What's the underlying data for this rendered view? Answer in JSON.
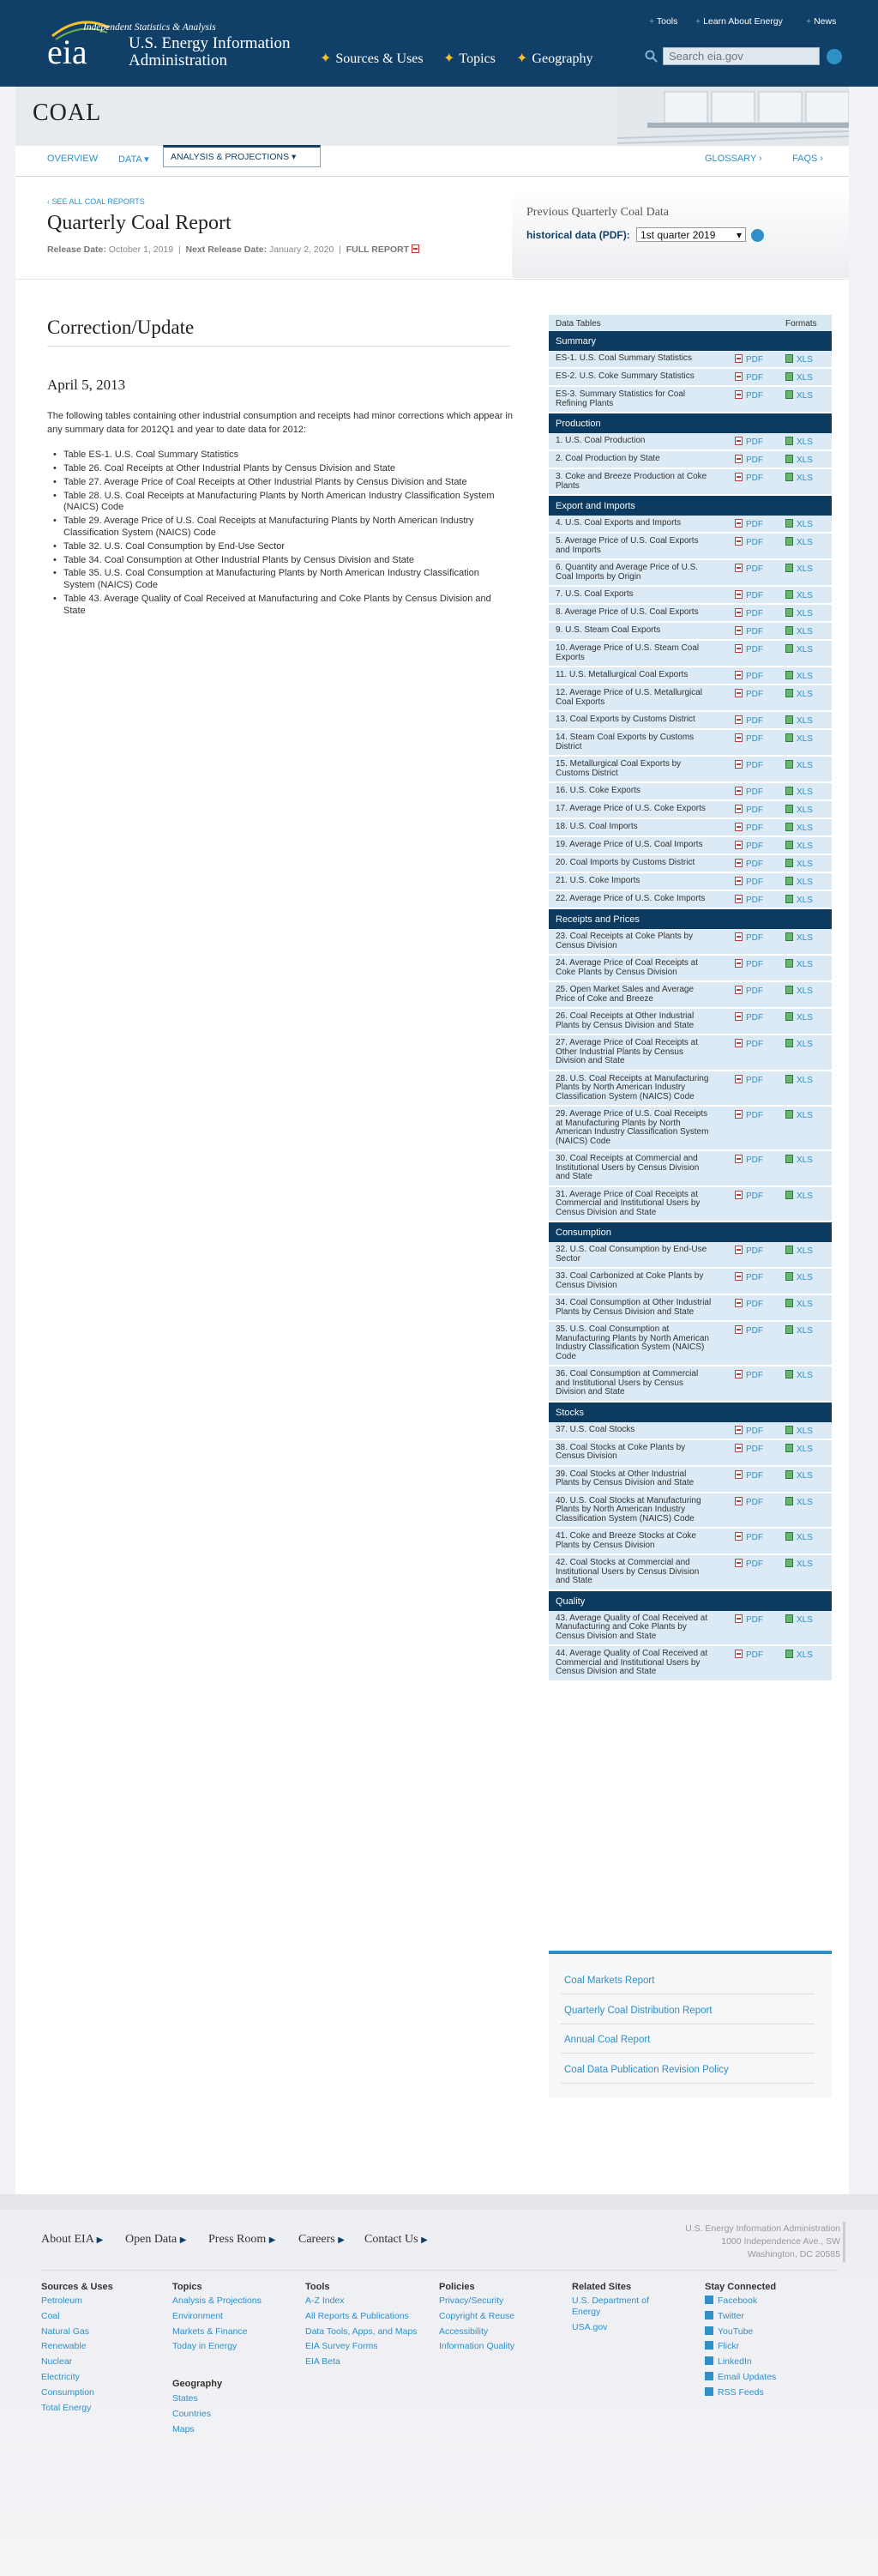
{
  "header": {
    "logo": "eia",
    "logo_tagline": "Independent Statistics & Analysis",
    "agency": "U.S. Energy Information Administration",
    "toplinks": [
      "Tools",
      "Learn About Energy",
      "News"
    ],
    "nav": [
      "Sources & Uses",
      "Topics",
      "Geography"
    ],
    "search_placeholder": "Search eia.gov"
  },
  "band": {
    "title": "COAL"
  },
  "tabs": {
    "overview": "OVERVIEW",
    "data": "DATA",
    "analysis": "ANALYSIS & PROJECTIONS",
    "glossary": "GLOSSARY ›",
    "faqs": "FAQS ›"
  },
  "report": {
    "crumb": "‹ SEE ALL COAL REPORTS",
    "title": "Quarterly Coal Report",
    "release_label": "Release Date:",
    "release_date": "October 1, 2019",
    "next_label": "Next Release Date:",
    "next_date": "January 2, 2020",
    "full_report": "FULL REPORT"
  },
  "previous": {
    "heading": "Previous Quarterly Coal Data",
    "label": "historical data (PDF):",
    "selected": "1st quarter 2019"
  },
  "correction": {
    "heading": "Correction/Update",
    "date": "April 5, 2013",
    "intro": "The following tables containing other industrial consumption and receipts had minor corrections which appear in any summary data for 2012Q1 and year to date data for 2012:",
    "items": [
      "Table ES-1. U.S. Coal Summary Statistics",
      "Table 26. Coal Receipts at Other Industrial Plants by Census Division and State",
      "Table 27. Average Price of Coal Receipts at Other Industrial Plants by Census Division and State",
      "Table 28. U.S. Coal Receipts at Manufacturing Plants by North American Industry Classification System (NAICS) Code",
      "Table 29. Average Price of U.S. Coal Receipts at Manufacturing Plants by North American Industry Classification System (NAICS) Code",
      "Table 32. U.S. Coal Consumption by End-Use Sector",
      "Table 34. Coal Consumption at Other Industrial Plants by Census Division and State",
      "Table 35. U.S. Coal Consumption at Manufacturing Plants by North American Industry Classification System (NAICS) Code",
      "Table 43. Average Quality of Coal Received at Manufacturing and Coke Plants by Census Division and State"
    ]
  },
  "data_tables": {
    "col1": "Data Tables",
    "col2": "Formats",
    "pdf": "PDF",
    "xls": "XLS",
    "sections": [
      {
        "title": "Summary",
        "rows": [
          "ES-1. U.S. Coal Summary Statistics",
          "ES-2. U.S. Coke Summary Statistics",
          "ES-3. Summary Statistics for Coal Refining Plants"
        ]
      },
      {
        "title": "Production",
        "rows": [
          "1. U.S. Coal Production",
          "2. Coal Production by State",
          "3. Coke and Breeze Production at Coke Plants"
        ]
      },
      {
        "title": "Export and Imports",
        "rows": [
          "4. U.S. Coal Exports and Imports",
          "5. Average Price of U.S. Coal Exports and Imports",
          "6. Quantity and Average Price of U.S. Coal Imports by Origin",
          "7. U.S. Coal Exports",
          "8. Average Price of U.S. Coal Exports",
          "9. U.S. Steam Coal Exports",
          "10. Average Price of U.S. Steam Coal Exports",
          "11. U.S. Metallurgical Coal Exports",
          "12. Average Price of U.S. Metallurgical Coal Exports",
          "13. Coal Exports by Customs District",
          "14. Steam Coal Exports by Customs District",
          "15. Metallurgical Coal Exports by Customs District",
          "16. U.S. Coke Exports",
          "17. Average Price of U.S. Coke Exports",
          "18. U.S. Coal Imports",
          "19. Average Price of U.S. Coal Imports",
          "20. Coal Imports by Customs District",
          "21. U.S. Coke Imports",
          "22. Average Price of U.S. Coke Imports"
        ]
      },
      {
        "title": "Receipts and Prices",
        "rows": [
          "23. Coal Receipts at Coke Plants by Census Division",
          "24. Average Price of Coal Receipts at Coke Plants by Census Division",
          "25. Open Market Sales and Average Price of Coke and Breeze",
          "26. Coal Receipts at Other Industrial Plants by Census Division and State",
          "27. Average Price of Coal Receipts at Other Industrial Plants by Census Division and State",
          "28. U.S. Coal Receipts at Manufacturing Plants by North American Industry Classification System (NAICS) Code",
          "29. Average Price of U.S. Coal Receipts at Manufacturing Plants by North American Industry Classification System (NAICS) Code",
          "30. Coal Receipts at Commercial and Institutional Users by Census Division and State",
          "31. Average Price of Coal Receipts at Commercial and Institutional Users by Census Division and State"
        ]
      },
      {
        "title": "Consumption",
        "rows": [
          "32. U.S. Coal Consumption by End-Use Sector",
          "33. Coal Carbonized at Coke Plants by Census Division",
          "34. Coal Consumption at Other Industrial Plants by Census Division and State",
          "35. U.S. Coal Consumption at Manufacturing Plants by North American Industry Classification System (NAICS) Code",
          "36. Coal Consumption at Commercial and Institutional Users by Census Division and State"
        ]
      },
      {
        "title": "Stocks",
        "rows": [
          "37. U.S. Coal Stocks",
          "38. Coal Stocks at Coke Plants by Census Division",
          "39. Coal Stocks at Other Industrial Plants by Census Division and State",
          "40. U.S. Coal Stocks at Manufacturing Plants by North American Industry Classification System (NAICS) Code",
          "41. Coke and Breeze Stocks at Coke Plants by Census Division",
          "42. Coal Stocks at Commercial and Institutional Users by Census Division and State"
        ]
      },
      {
        "title": "Quality",
        "rows": [
          "43. Average Quality of Coal Received at Manufacturing and Coke Plants by Census Division and State",
          "44. Average Quality of Coal Received at Commercial and Institutional Users by Census Division and State"
        ]
      }
    ]
  },
  "related": [
    "Coal Markets Report",
    "Quarterly Coal Distribution Report",
    "Annual Coal Report",
    "Coal Data Publication Revision Policy"
  ],
  "footer": {
    "nav": [
      "About EIA",
      "Open Data",
      "Press Room",
      "Careers",
      "Contact Us"
    ],
    "address": [
      "U.S. Energy Information Administration",
      "1000 Independence Ave., SW",
      "Washington, DC 20585"
    ],
    "columns": [
      {
        "title": "Sources & Uses",
        "links": [
          "Petroleum",
          "Coal",
          "Natural Gas",
          "Renewable",
          "Nuclear",
          "Electricity",
          "Consumption",
          "Total Energy"
        ]
      },
      {
        "title": "Topics",
        "links": [
          "Analysis & Projections",
          "Environment",
          "Markets & Finance",
          "Today in Energy"
        ]
      },
      {
        "title": "Tools",
        "links": [
          "A-Z Index",
          "All Reports & Publications",
          "Data Tools, Apps, and Maps",
          "EIA Survey Forms",
          "EIA Beta"
        ]
      },
      {
        "title": "Policies",
        "links": [
          "Privacy/Security",
          "Copyright & Reuse",
          "Accessibility",
          "Information Quality"
        ]
      },
      {
        "title": "Related Sites",
        "links": [
          "U.S. Department of Energy",
          "USA.gov"
        ]
      },
      {
        "title": "Stay Connected",
        "links": [
          "Facebook",
          "Twitter",
          "YouTube",
          "Flickr",
          "LinkedIn",
          "Email Updates",
          "RSS Feeds"
        ]
      }
    ],
    "geo_title": "Geography",
    "geo_links": [
      "States",
      "Countries",
      "Maps"
    ]
  }
}
